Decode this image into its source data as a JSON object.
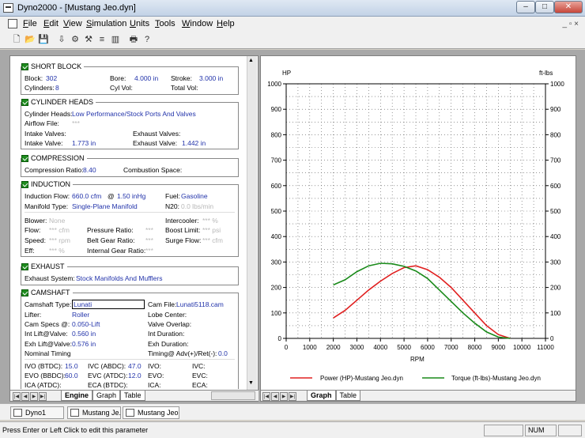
{
  "window": {
    "title": "Dyno2000 - [Mustang Jeo.dyn]",
    "min": "–",
    "max": "□",
    "close": "✕"
  },
  "menu": [
    "File",
    "Edit",
    "View",
    "Simulation",
    "Units",
    "Tools",
    "Window",
    "Help"
  ],
  "menu_underline": [
    "F",
    "E",
    "V",
    "S",
    "U",
    "T",
    "W",
    "H"
  ],
  "mdi_controls": "_ ▫ ×",
  "short_block": {
    "title": "SHORT BLOCK",
    "block_label": "Block:",
    "block_value": "302",
    "cyl_label": "Cylinders:",
    "cyl_value": "8",
    "bore_label": "Bore:",
    "bore_value": "4.000 in",
    "stroke_label": "Stroke:",
    "stroke_value": "3.000 in",
    "cylvol_label": "Cyl Vol:",
    "totvol_label": "Total Vol:"
  },
  "cylinder_heads": {
    "title": "CYLINDER HEADS",
    "heads_label": "Cylinder Heads:",
    "heads_value": "Low Performance/Stock Ports And Valves",
    "airflow_label": "Airflow File:",
    "airflow_value": "***",
    "intake_valves_label": "Intake Valves:",
    "exhaust_valves_label": "Exhaust Valves:",
    "intake_valve_label": "Intake Valve:",
    "intake_valve_value": "1.773 in",
    "exhaust_valve_label": "Exhaust Valve:",
    "exhaust_valve_value": "1.442 in"
  },
  "compression": {
    "title": "COMPRESSION",
    "ratio_label": "Compression Ratio:",
    "ratio_value": "8.40",
    "space_label": "Combustion Space:"
  },
  "induction": {
    "title": "INDUCTION",
    "flow_label": "Induction Flow:",
    "flow_value": "660.0 cfm",
    "flow_at": "@",
    "flow_hg": "1.50 inHg",
    "fuel_label": "Fuel:",
    "fuel_value": "Gasoline",
    "manifold_label": "Manifold Type:",
    "manifold_value": "Single-Plane Manifold",
    "n20_label": "N20:",
    "n20_value": "0.0 lbs/min",
    "blower_label": "Blower:",
    "blower_value": "None",
    "intercooler_label": "Intercooler:",
    "intercooler_value": "*** %",
    "flow2_label": "Flow:",
    "flow2_value": "*** cfm",
    "pressure_label": "Pressure Ratio:",
    "pressure_value": "***",
    "boost_label": "Boost Limit:",
    "boost_value": "*** psi",
    "speed_label": "Speed:",
    "speed_value": "*** rpm",
    "belt_label": "Belt Gear Ratio:",
    "belt_value": "***",
    "surge_label": "Surge Flow:",
    "surge_value": "*** cfm",
    "eff_label": "Eff:",
    "eff_value": "*** %",
    "internal_label": "Internal Gear Ratio:",
    "internal_value": "***"
  },
  "exhaust": {
    "title": "EXHAUST",
    "system_label": "Exhaust System:",
    "system_value": "Stock Manifolds And Mufflers"
  },
  "camshaft": {
    "title": "CAMSHAFT",
    "type_label": "Camshaft Type:",
    "type_value": "Lunati",
    "file_label": "Cam File:",
    "file_value": "Lunati5118.cam",
    "lifter_label": "Lifter:",
    "lifter_value": "Roller",
    "lobe_label": "Lobe Center:",
    "specs_label": "Cam Specs @:",
    "specs_value": "0.050-Lift",
    "overlap_label": "Valve Overlap:",
    "int_lift_label": "Int Lift@Valve:",
    "int_lift_value": "0.560 in",
    "int_dur_label": "Int Duration:",
    "exh_lift_label": "Exh Lift@Valve:",
    "exh_lift_value": "0.576 in",
    "exh_dur_label": "Exh Duration:",
    "nominal_label": "Nominal Timing",
    "timing_label": "Timing@ Adv(+)/Ret(-):",
    "timing_value": "0.0",
    "ivo_label": "IVO (BTDC):",
    "ivo_value": "15.0",
    "ivc_label": "IVC (ABDC):",
    "ivc_value": "47.0",
    "ivo2_label": "IVO:",
    "ivc2_label": "IVC:",
    "evo_label": "EVO (BBDC):",
    "evo_value": "60.0",
    "evc_label": "EVC (ATDC):",
    "evc_value": "12.0",
    "evo2_label": "EVO:",
    "evc2_label": "EVC:",
    "ica_label": "ICA (ATDC):",
    "eca_label": "ECA (BTDC):",
    "ica2_label": "ICA:",
    "eca2_label": "ECA:"
  },
  "left_tabs": [
    "Engine",
    "Graph",
    "Table"
  ],
  "right_tabs": [
    "Graph",
    "Table"
  ],
  "doc_tabs": [
    "Dyno1",
    "Mustang Je...",
    "Mustang Jeo..."
  ],
  "status": {
    "text": "Press Enter or Left Click to edit this parameter",
    "num": "NUM"
  },
  "colors": {
    "power": "#e02020",
    "torque": "#1a8a1a"
  },
  "chart_data": {
    "type": "line",
    "ylabel_left": "HP",
    "ylabel_right": "ft-lbs",
    "xlabel": "RPM",
    "xlim": [
      0,
      11000
    ],
    "ylim": [
      0,
      1000
    ],
    "x_ticks": [
      "0",
      "1000",
      "2000",
      "3000",
      "4000",
      "5000",
      "6000",
      "7000",
      "8000",
      "9000",
      "10000",
      "11000"
    ],
    "y_ticks": [
      "0",
      "100",
      "200",
      "300",
      "400",
      "500",
      "600",
      "700",
      "800",
      "900",
      "1000"
    ],
    "grid": true,
    "legend_position": "bottom",
    "series": [
      {
        "name": "Power (HP)-Mustang Jeo.dyn",
        "color": "#e02020",
        "x": [
          2000,
          2500,
          3000,
          3500,
          4000,
          4500,
          5000,
          5500,
          6000,
          6500,
          7000,
          7500,
          8000,
          8500,
          9000,
          9500
        ],
        "y": [
          80,
          110,
          150,
          190,
          225,
          255,
          278,
          285,
          270,
          240,
          200,
          150,
          100,
          50,
          15,
          0
        ]
      },
      {
        "name": "Torque (ft-lbs)-Mustang Jeo.dyn",
        "color": "#1a8a1a",
        "x": [
          2000,
          2500,
          3000,
          3500,
          4000,
          4500,
          5000,
          5500,
          6000,
          6500,
          7000,
          7500,
          8000,
          8500,
          9000,
          9500
        ],
        "y": [
          210,
          230,
          262,
          285,
          295,
          293,
          283,
          265,
          235,
          190,
          145,
          100,
          60,
          25,
          5,
          0
        ]
      }
    ]
  }
}
